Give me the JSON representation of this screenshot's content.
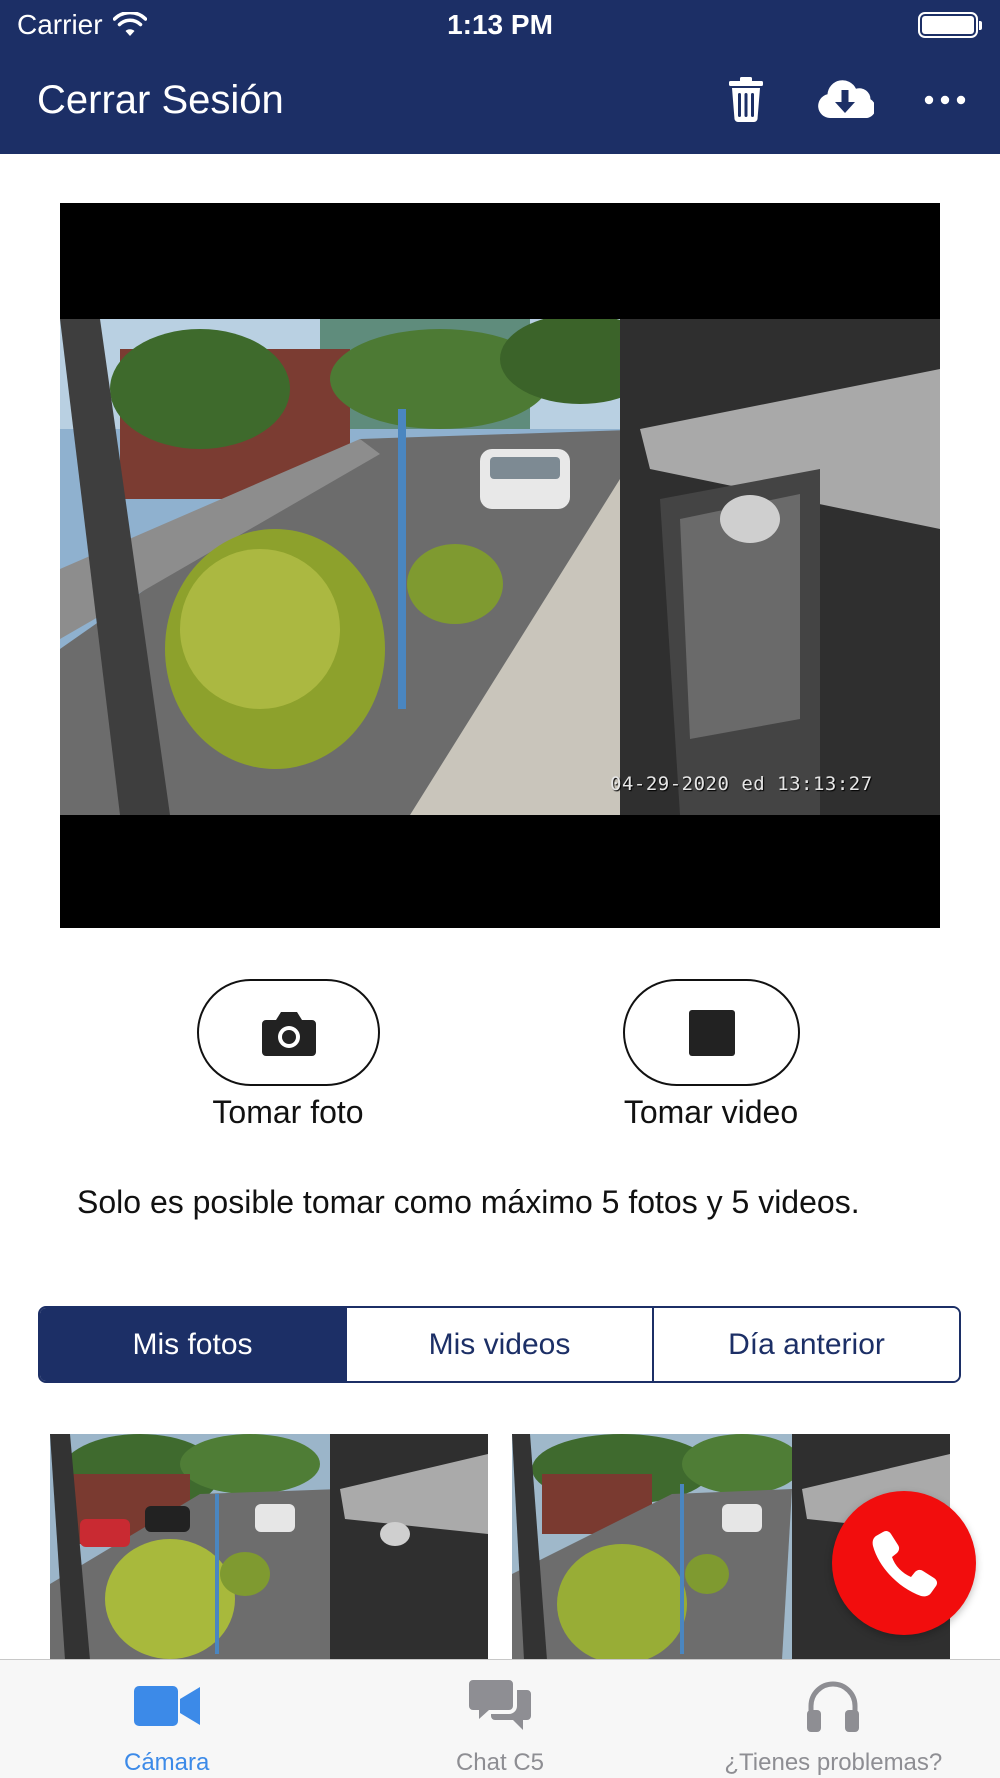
{
  "status_bar": {
    "carrier": "Carrier",
    "time": "1:13 PM"
  },
  "nav": {
    "title": "Cerrar Sesión",
    "actions": [
      "trash-icon",
      "cloud-download-icon",
      "more-icon"
    ]
  },
  "camera": {
    "osd_timestamp": "04-29-2020  ed 13:13:27"
  },
  "capture": {
    "photo_label": "Tomar foto",
    "video_label": "Tomar video",
    "photo_icon": "camera-icon",
    "video_icon": "stop-square-icon"
  },
  "notice": "Solo es posible tomar como máximo 5 fotos y 5 videos.",
  "segments": {
    "selected": "Mis fotos",
    "items": [
      "Mis fotos",
      "Mis videos",
      "Día anterior"
    ]
  },
  "gallery": {
    "thumb_count_visible": 2
  },
  "call_button": {
    "icon": "phone-icon",
    "color": "#f20d0d"
  },
  "tabbar": {
    "items": [
      {
        "label": "Cámara",
        "icon": "video-camera-icon",
        "active": true
      },
      {
        "label": "Chat C5",
        "icon": "chat-icon",
        "active": false
      },
      {
        "label": "¿Tienes problemas?",
        "icon": "headphones-icon",
        "active": false
      }
    ]
  },
  "colors": {
    "nav_bg": "#1c2f66",
    "accent": "#3c8ae8",
    "inactive_tab": "#8e8e93"
  }
}
